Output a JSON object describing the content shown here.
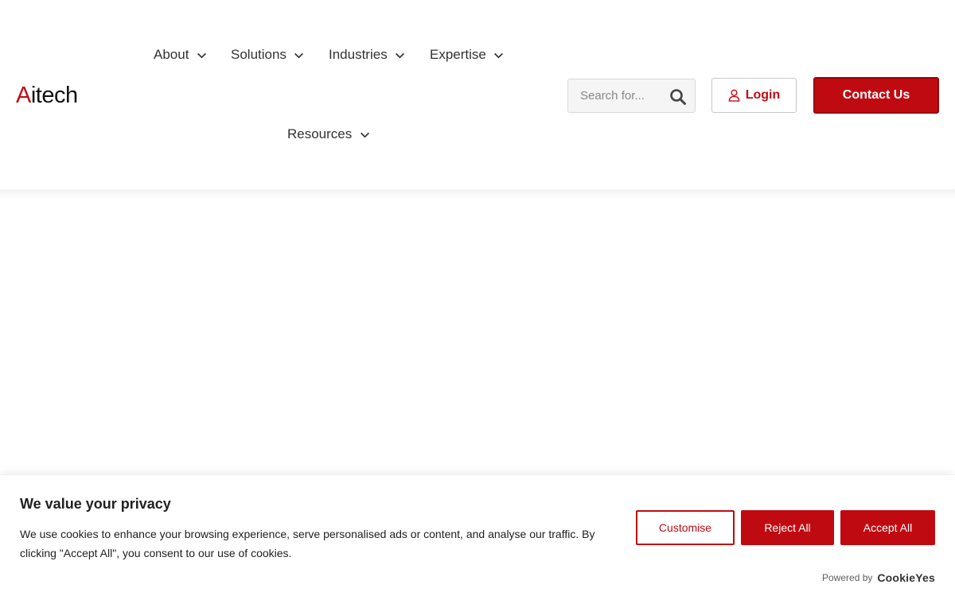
{
  "header": {
    "logo": {
      "accent": "A",
      "rest": "itech",
      "accent_color": "#c40a14"
    },
    "nav": [
      {
        "label": "About",
        "icon": "chevron-down-icon"
      },
      {
        "label": "Solutions",
        "icon": "chevron-down-icon"
      },
      {
        "label": "Industries",
        "icon": "chevron-down-icon"
      },
      {
        "label": "Expertise",
        "icon": "chevron-down-icon"
      },
      {
        "label": "Resources",
        "icon": "chevron-down-icon"
      }
    ],
    "search": {
      "placeholder": "Search for...",
      "value": "",
      "icon": "search-icon"
    },
    "login_label": "Login",
    "login_icon": "user-icon",
    "contact_label": "Contact Us"
  },
  "cookie_banner": {
    "title": "We value your privacy",
    "text": "We use cookies to enhance your browsing experience, serve personalised ads or content, and analyse our traffic. By clicking \"Accept All\", you consent to our use of cookies.",
    "customise_label": "Customise",
    "reject_label": "Reject All",
    "accept_label": "Accept All",
    "powered_by_label": "Powered by",
    "powered_brand": "CookieYes"
  },
  "colors": {
    "brand_red": "#c00a12",
    "text_dark": "#333333"
  }
}
